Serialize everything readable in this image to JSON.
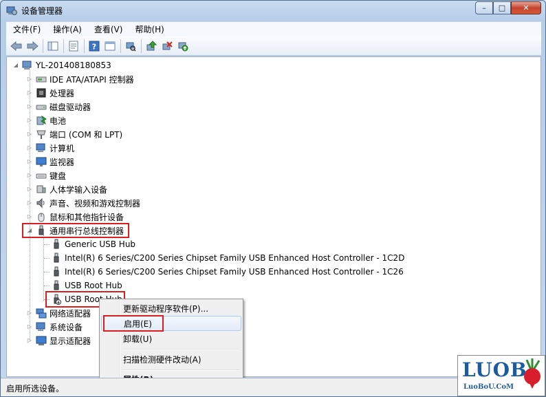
{
  "window": {
    "title": "设备管理器",
    "controls": {
      "minimize": "–",
      "maximize": "□",
      "close": "✕"
    }
  },
  "menu": [
    "文件(F)",
    "操作(A)",
    "查看(V)",
    "帮助(H)"
  ],
  "toolbar_icons": [
    "back-arrow-icon",
    "forward-arrow-icon",
    "console-tree-icon",
    "properties-icon",
    "help-icon",
    "device-view-icon",
    "scan-hardware-icon",
    "update-driver-icon",
    "uninstall-icon",
    "enable-device-icon"
  ],
  "tree": {
    "root": "YL-201408180853",
    "categories": [
      {
        "label": "IDE ATA/ATAPI 控制器",
        "icon": "ide-controller-icon"
      },
      {
        "label": "处理器",
        "icon": "processor-icon"
      },
      {
        "label": "磁盘驱动器",
        "icon": "disk-drive-icon"
      },
      {
        "label": "电池",
        "icon": "battery-icon"
      },
      {
        "label": "端口 (COM 和 LPT)",
        "icon": "port-icon"
      },
      {
        "label": "计算机",
        "icon": "computer-icon"
      },
      {
        "label": "监视器",
        "icon": "monitor-icon"
      },
      {
        "label": "键盘",
        "icon": "keyboard-icon"
      },
      {
        "label": "人体学输入设备",
        "icon": "hid-icon"
      },
      {
        "label": "声音、视频和游戏控制器",
        "icon": "sound-icon"
      },
      {
        "label": "鼠标和其他指针设备",
        "icon": "mouse-icon"
      },
      {
        "label": "通用串行总线控制器",
        "icon": "usb-icon",
        "expanded": true
      }
    ],
    "usb_children": [
      "Generic USB Hub",
      "Intel(R) 6 Series/C200 Series Chipset Family USB Enhanced Host Controller - 1C2D",
      "Intel(R) 6 Series/C200 Series Chipset Family USB Enhanced Host Controller - 1C26",
      "USB Root Hub",
      "USB Root Hub"
    ],
    "after_categories": [
      {
        "label": "网络适配器",
        "icon": "network-adapter-icon"
      },
      {
        "label": "系统设备",
        "icon": "system-device-icon"
      },
      {
        "label": "显示适配器",
        "icon": "display-adapter-icon"
      }
    ]
  },
  "context_menu": {
    "items": [
      "更新驱动程序软件(P)...",
      "启用(E)",
      "卸载(U)",
      "扫描检测硬件改动(A)",
      "属性(R)"
    ],
    "highlighted_index": 1
  },
  "status": "启用所选设备。",
  "logo": {
    "main": "LUOB",
    "sub": "LuoBoU.CoM"
  },
  "colors": {
    "highlight_red": "#d81e1e",
    "accent_blue": "#1d5c9c"
  }
}
